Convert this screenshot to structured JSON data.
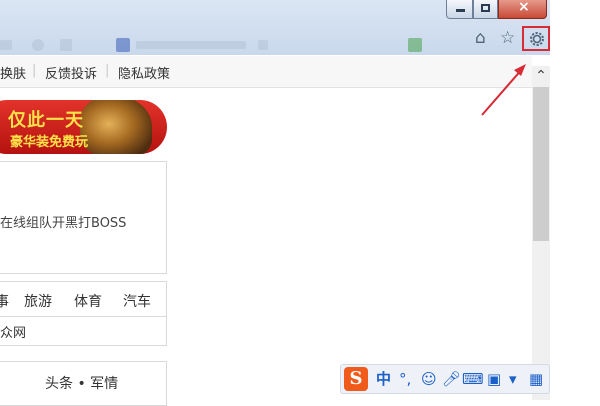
{
  "window": {
    "controls": {
      "minimize_icon": "minimize-icon",
      "restore_icon": "restore-icon",
      "close_icon": "close-icon"
    }
  },
  "toolbar": {
    "icons": [
      "home-icon",
      "star-icon",
      "gear-icon"
    ]
  },
  "top_links": [
    "换肤",
    "反馈投诉",
    "隐私政策"
  ],
  "banner": {
    "line1": "仅此一天",
    "line2": "豪华装免费玩"
  },
  "game_panel": {
    "text": "在线组队开黑打BOSS"
  },
  "nav": [
    "事",
    "旅游",
    "体育",
    "汽车"
  ],
  "site": {
    "text": "众网"
  },
  "news": {
    "text": "头条 • 军情"
  },
  "ime": {
    "logo": "S",
    "lang": "中",
    "punct": "°,",
    "icons": [
      "smile-icon",
      "mic-icon",
      "keyboard-icon",
      "toolbox-icon",
      "skin-icon",
      "grid-icon"
    ]
  },
  "colors": {
    "highlight": "#d72b35",
    "ime_orange": "#f05a1a",
    "banner_red": "#c81d18"
  }
}
